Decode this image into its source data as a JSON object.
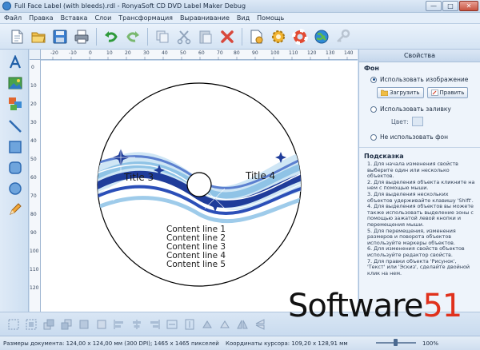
{
  "window": {
    "title": "Full Face Label (with bleeds).rdl - RonyaSoft CD DVD Label Maker Debug",
    "minimize": "—",
    "maximize": "□",
    "close": "✕"
  },
  "menu": [
    "Файл",
    "Правка",
    "Вставка",
    "Слои",
    "Трансформация",
    "Выравнивание",
    "Вид",
    "Помощь"
  ],
  "ruler": {
    "top_ticks": [
      "-20",
      "-10",
      "0",
      "10",
      "20",
      "30",
      "40",
      "50",
      "60",
      "70",
      "80",
      "90",
      "100",
      "110",
      "120",
      "130",
      "140"
    ],
    "left_ticks": [
      "0",
      "10",
      "20",
      "30",
      "40",
      "50",
      "60",
      "70",
      "80",
      "90",
      "100",
      "110",
      "120"
    ]
  },
  "label": {
    "title_left": "Title 3",
    "title_right": "Title 4",
    "content_lines": [
      "Content line 1",
      "Content line 2",
      "Content line 3",
      "Content line 4",
      "Content line 5"
    ]
  },
  "panel": {
    "header": "Свойства",
    "bg_section": "Фон",
    "use_image": "Использовать изображение",
    "load_button": "Загрузить",
    "edit_button": "Править",
    "use_fill": "Использовать заливку",
    "color_label": "Цвет:",
    "no_bg": "Не использовать фон",
    "hint_title": "Подсказка",
    "hints": [
      "1. Для начала изменения свойств выберите один или несколько объектов.",
      "2. Для выделения объекта кликните на нем с помощью мыши.",
      "3. Для выделения нескольких объектов удерживайте клавишу 'Shift'.",
      "4. Для выделения объектов вы можете также использовать выделение зоны с помощью зажатой левой кнопки и перемещения мыши.",
      "5. Для перемещения, изменения размеров и поворота объектов используйте маркеры объектов.",
      "6. Для изменения свойств объектов используйте редактор свойств.",
      "7. Для правки объекта 'Рисунок', 'Текст' или 'Эскиз', сделайте двойной клик на нем."
    ]
  },
  "status": {
    "doc_size": "Размеры документа: 124,00 x 124,00 мм (300 DPI); 1465 x 1465 пикселей",
    "coords": "Координаты курсора: 109,20 x 128,91 мм",
    "zoom": "100%"
  },
  "watermark": {
    "prefix": "Software",
    "suffix": "51"
  },
  "colors": {
    "accent": "#1a4f8c",
    "panel_bg": "#eef4fb",
    "toolbar_bg": "#d4e3f3"
  }
}
